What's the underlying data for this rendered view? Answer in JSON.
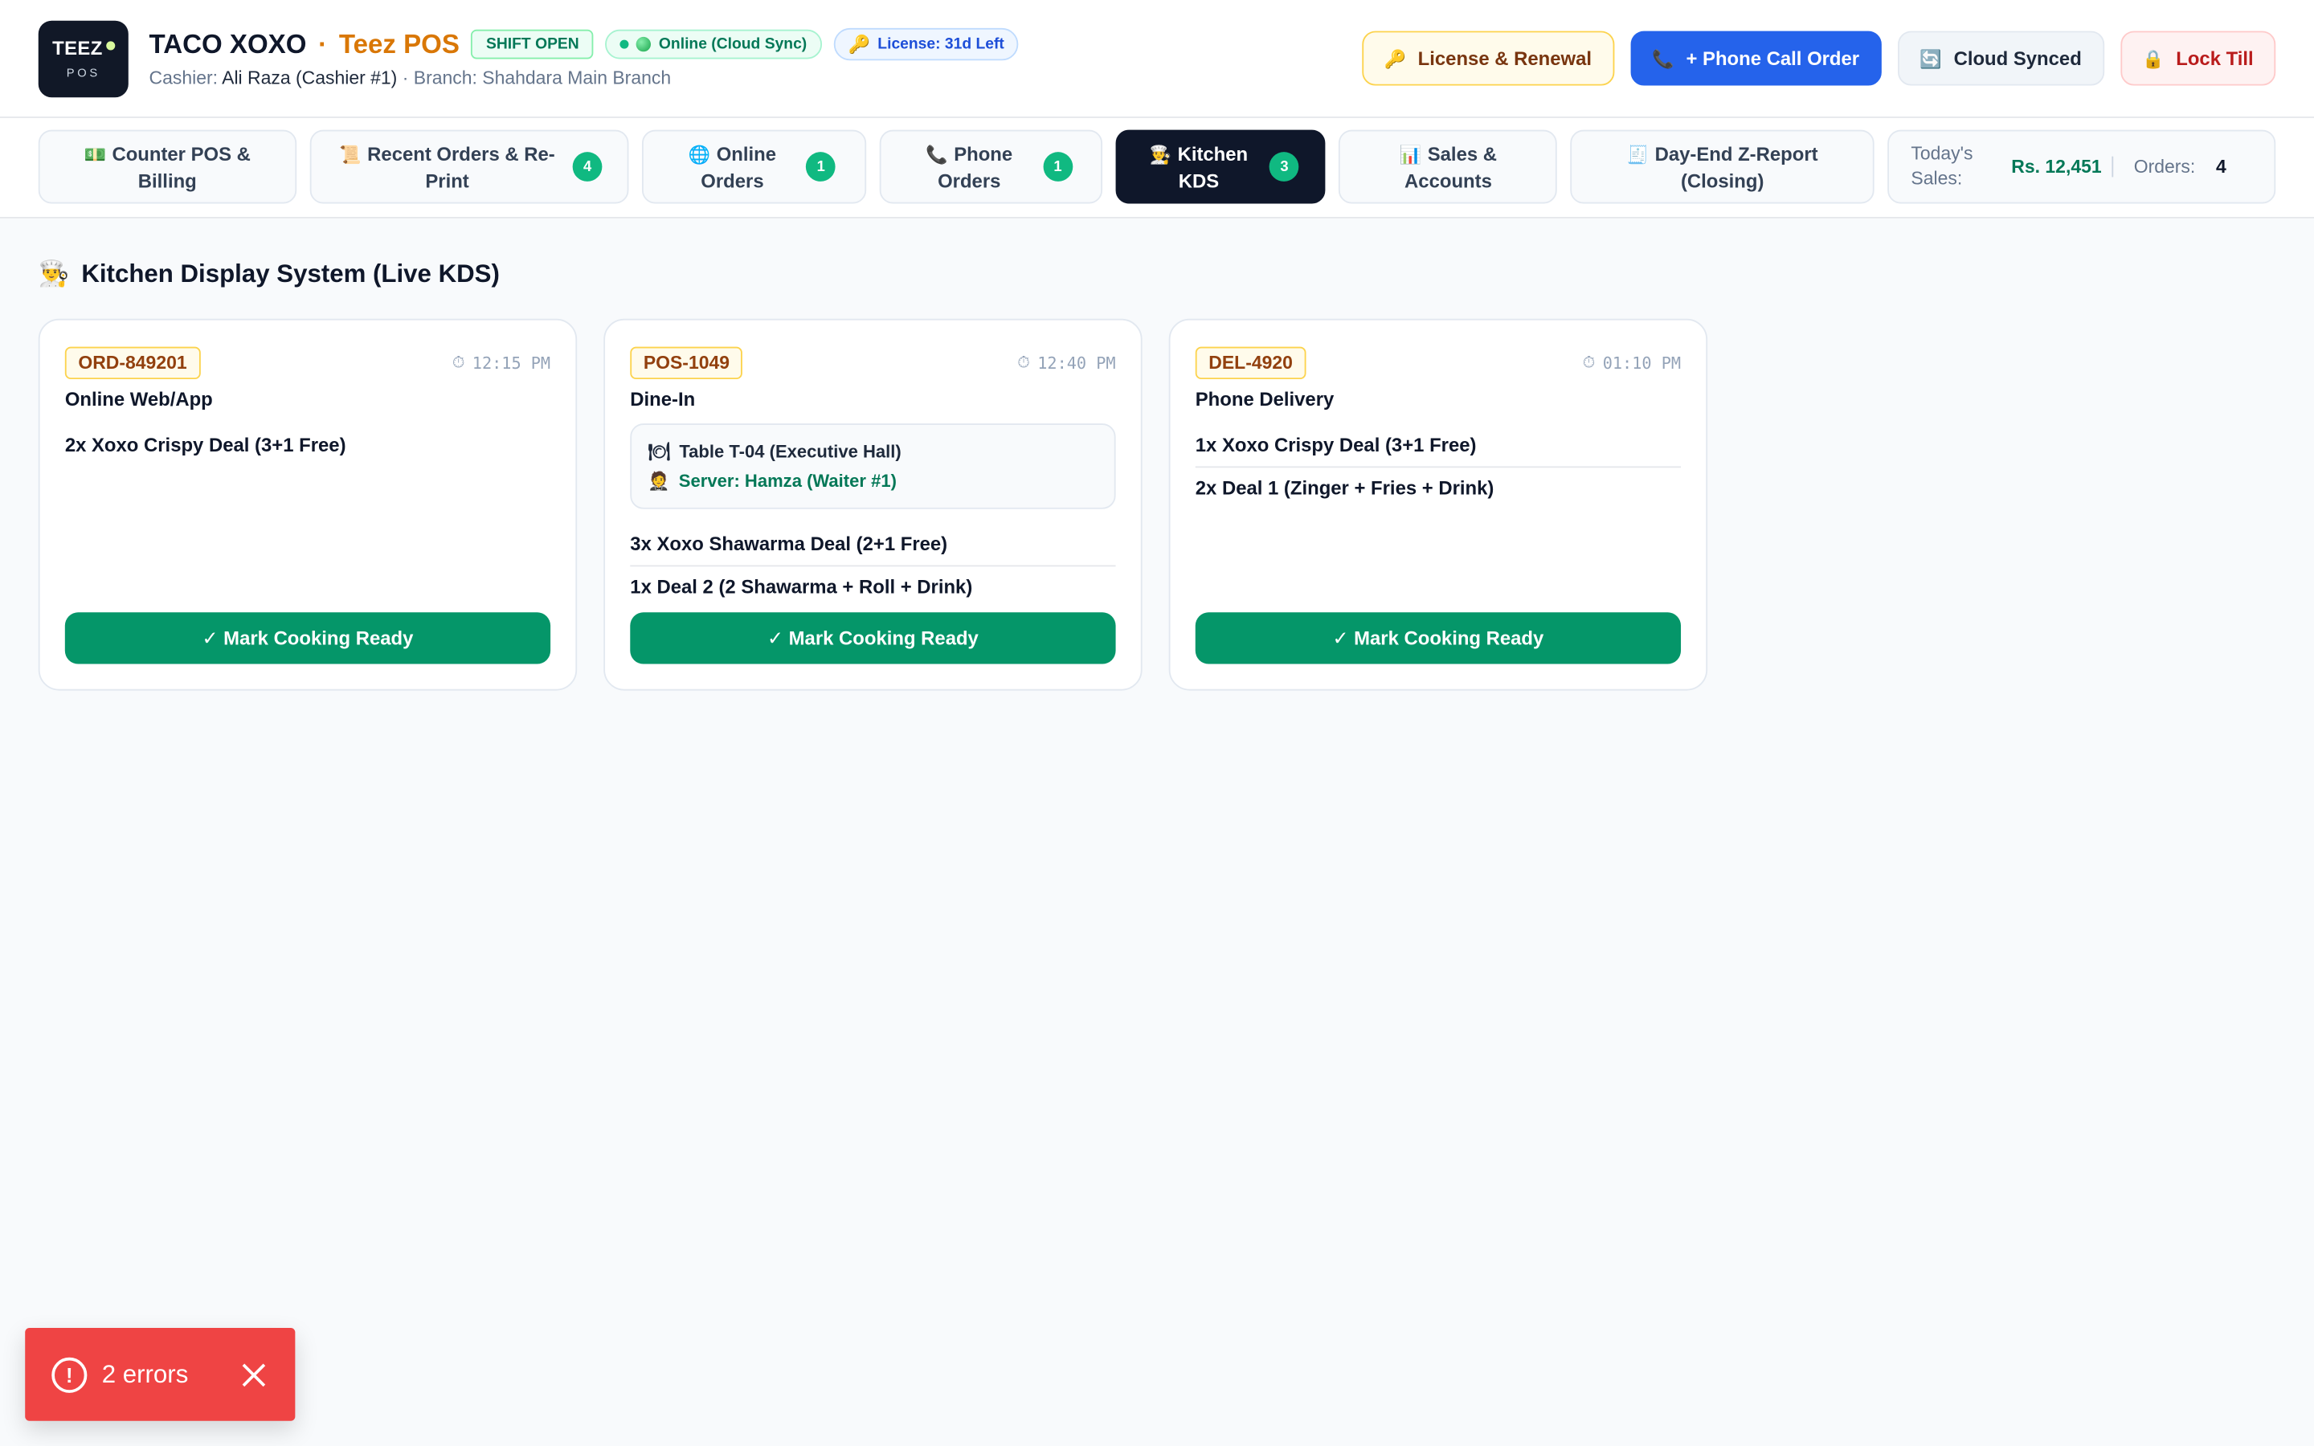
{
  "header": {
    "logo_text": "TEEZ",
    "logo_sub": "POS",
    "brand_name": "TACO XOXO",
    "brand_separator": "·",
    "brand_pos": "Teez POS",
    "shift_status": "SHIFT OPEN",
    "online_status": "Online (Cloud Sync)",
    "license_status": "License: 31d Left",
    "cashier_label": "Cashier:",
    "cashier_name": "Ali Raza (Cashier #1)",
    "branch_text": "· Branch: Shahdara Main Branch",
    "actions": {
      "license_renewal": "License & Renewal",
      "phone_call_order": "+ Phone Call Order",
      "cloud_synced": "Cloud Synced",
      "lock_till": "Lock Till"
    }
  },
  "nav": {
    "tabs": [
      {
        "icon": "💵",
        "label": "Counter POS & Billing",
        "badge": null
      },
      {
        "icon": "📜",
        "label": "Recent Orders & Re-Print",
        "badge": "4"
      },
      {
        "icon": "🌐",
        "label": "Online Orders",
        "badge": "1"
      },
      {
        "icon": "📞",
        "label": "Phone Orders",
        "badge": "1"
      },
      {
        "icon": "👨‍🍳",
        "label": "Kitchen KDS",
        "badge": "3"
      },
      {
        "icon": "📊",
        "label": "Sales & Accounts",
        "badge": null
      },
      {
        "icon": "🧾",
        "label": "Day-End Z-Report (Closing)",
        "badge": null
      }
    ],
    "stats": {
      "sales_label": "Today's Sales:",
      "sales_value": "Rs. 12,451",
      "orders_label": "Orders:",
      "orders_value": "4"
    }
  },
  "kds": {
    "title_icon": "👨‍🍳",
    "title": "Kitchen Display System (Live KDS)",
    "orders": [
      {
        "id": "ORD-849201",
        "time": "12:15 PM",
        "type": "Online Web/App",
        "items": [
          "2x Xoxo Crispy Deal (3+1 Free)"
        ],
        "button": "✓ Mark Cooking Ready"
      },
      {
        "id": "POS-1049",
        "time": "12:40 PM",
        "type": "Dine-In",
        "table": "Table T-04 (Executive Hall)",
        "server": "Server: Hamza (Waiter #1)",
        "items": [
          "3x Xoxo Shawarma Deal (2+1 Free)",
          "1x Deal 2 (2 Shawarma + Roll + Drink)"
        ],
        "button": "✓ Mark Cooking Ready"
      },
      {
        "id": "DEL-4920",
        "time": "01:10 PM",
        "type": "Phone Delivery",
        "items": [
          "1x Xoxo Crispy Deal (3+1 Free)",
          "2x Deal 1 (Zinger + Fries + Drink)"
        ],
        "button": "✓ Mark Cooking Ready"
      }
    ]
  },
  "toast": {
    "icon": "!",
    "text": "2 errors"
  },
  "colors": {
    "brand_orange": "#d97706",
    "phone_blue": "#2563eb",
    "ready_green": "#059669",
    "active_tab": "#0f172a",
    "error_red": "#ef4444"
  }
}
